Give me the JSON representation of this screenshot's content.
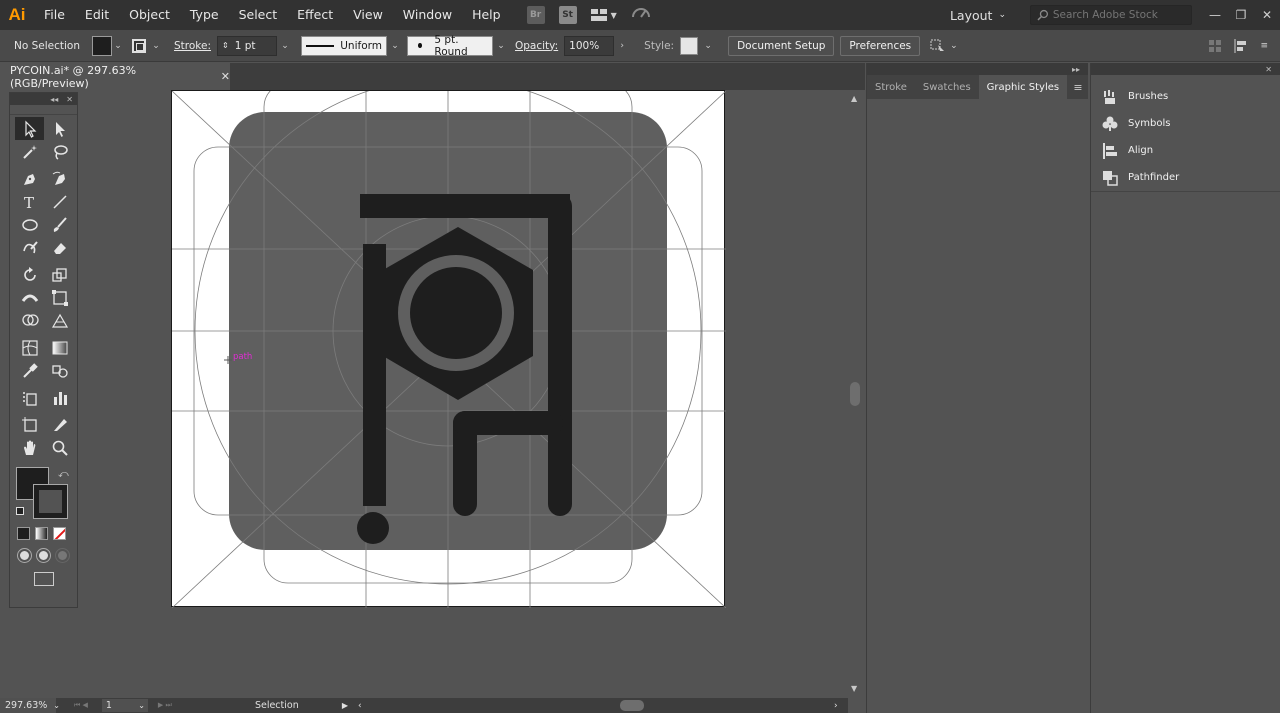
{
  "app": {
    "logo": "Ai"
  },
  "menu": {
    "items": [
      "File",
      "Edit",
      "Object",
      "Type",
      "Select",
      "Effect",
      "View",
      "Window",
      "Help"
    ],
    "bridge": "Br",
    "stock": "St",
    "workspace": "Layout",
    "search_placeholder": "Search Adobe Stock"
  },
  "control": {
    "selection": "No Selection",
    "stroke_label": "Stroke:",
    "stroke_weight": "1 pt",
    "profile": "Uniform",
    "brush": "5 pt. Round",
    "opacity_label": "Opacity:",
    "opacity": "100%",
    "style_label": "Style:",
    "document_setup": "Document Setup",
    "preferences": "Preferences"
  },
  "document": {
    "tab_title": "PYCOIN.ai* @ 297.63% (RGB/Preview)",
    "hover_label": "path"
  },
  "status": {
    "zoom": "297.63%",
    "page": "1",
    "tool": "Selection"
  },
  "panels": {
    "tabs": [
      "Stroke",
      "Swatches",
      "Graphic Styles"
    ],
    "active_tab": "Graphic Styles",
    "collapsed": [
      "Brushes",
      "Symbols",
      "Align",
      "Pathfinder"
    ]
  },
  "colors": {
    "fill": "#1e1e1e",
    "app_accent": "#ff9a00",
    "hover_label": "#e22bd6"
  }
}
